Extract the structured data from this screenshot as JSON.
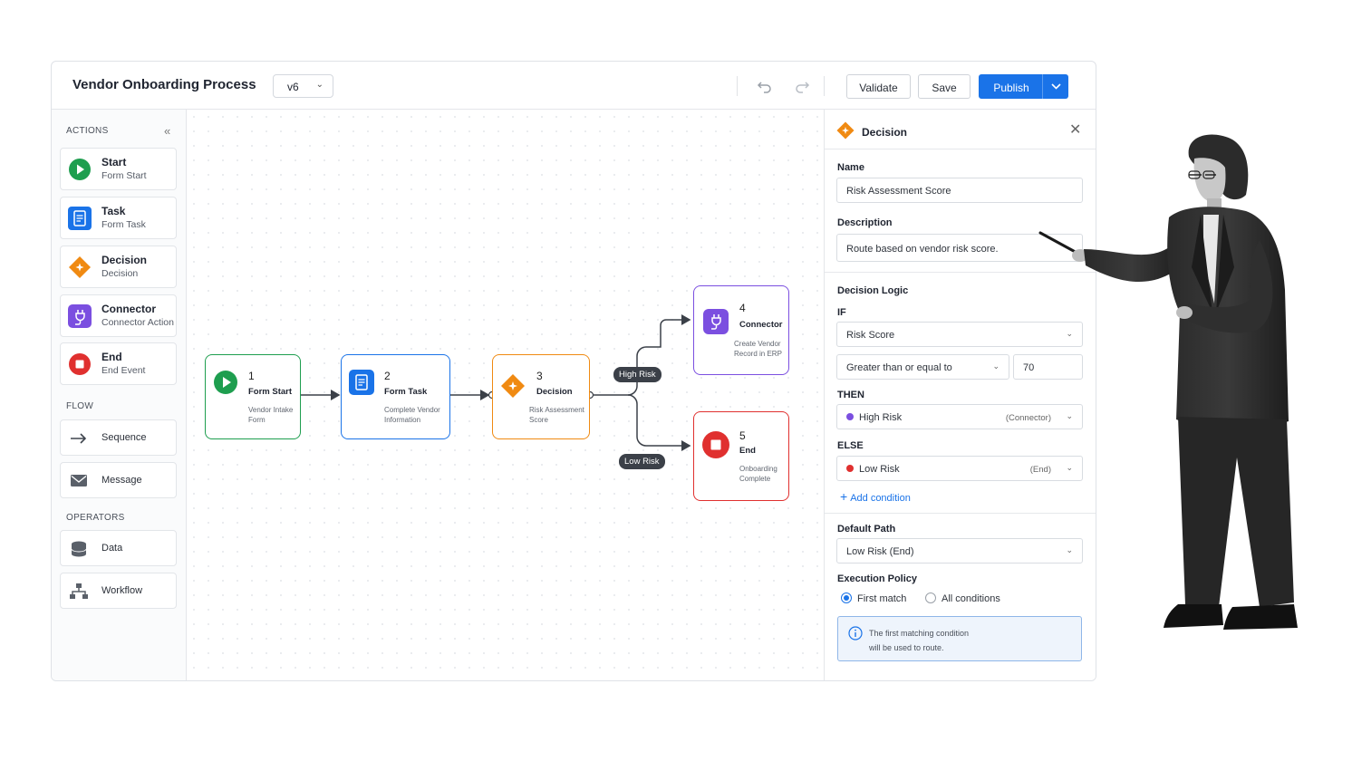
{
  "header": {
    "title": "Vendor Onboarding Process",
    "version": "v6",
    "validate_label": "Validate",
    "save_label": "Save",
    "publish_label": "Publish"
  },
  "sidebar": {
    "actions_label": "ACTIONS",
    "actions": [
      {
        "title": "Start",
        "subtitle": "Form Start",
        "icon": "play-icon",
        "color": "#1e9e4f"
      },
      {
        "title": "Task",
        "subtitle": "Form Task",
        "icon": "document-icon",
        "color": "#1a73e8"
      },
      {
        "title": "Decision",
        "subtitle": "Decision",
        "icon": "diamond-icon",
        "color": "#f08a12"
      },
      {
        "title": "Connector",
        "subtitle": "Connector Action",
        "icon": "plug-icon",
        "color": "#7b4fe0"
      },
      {
        "title": "End",
        "subtitle": "End Event",
        "icon": "stop-icon",
        "color": "#e0302f"
      }
    ],
    "flow_label": "FLOW",
    "flow": [
      {
        "title": "Sequence",
        "icon": "arrow-right-icon"
      },
      {
        "title": "Message",
        "icon": "envelope-icon"
      }
    ],
    "operators_label": "OPERATORS",
    "operators": [
      {
        "title": "Data",
        "icon": "database-icon"
      },
      {
        "title": "Workflow",
        "icon": "hierarchy-icon"
      }
    ]
  },
  "canvas": {
    "nodes": [
      {
        "num": "1",
        "title": "Form Start",
        "desc1": "Vendor Intake",
        "desc2": "Form",
        "color": "#1e9e4f"
      },
      {
        "num": "2",
        "title": "Form Task",
        "desc1": "Complete Vendor",
        "desc2": "Information",
        "color": "#1a73e8"
      },
      {
        "num": "3",
        "title": "Decision",
        "desc1": "Risk Assessment",
        "desc2": "Score",
        "color": "#f08a12"
      },
      {
        "num": "4",
        "title": "Connector",
        "desc1": "Create Vendor",
        "desc2": "Record in ERP",
        "color": "#7b4fe0"
      },
      {
        "num": "5",
        "title": "End",
        "desc1": "Onboarding",
        "desc2": "Complete",
        "color": "#e0302f"
      }
    ],
    "edge_labels": {
      "high": "High Risk",
      "low": "Low Risk"
    }
  },
  "panel": {
    "title": "Decision",
    "name_label": "Name",
    "name_value": "Risk Assessment Score",
    "description_label": "Description",
    "description_value": "Route based on vendor risk score.",
    "logic_label": "Decision Logic",
    "if_label": "IF",
    "if_field": "Risk Score",
    "operator": "Greater than or equal to",
    "threshold": "70",
    "then_label": "THEN",
    "then_value": "High Risk",
    "then_type": "(Connector)",
    "else_label": "ELSE",
    "else_value": "Low Risk",
    "else_type": "(End)",
    "add_condition": "Add condition",
    "default_label": "Default Path",
    "default_value": "Low Risk (End)",
    "policy_label": "Execution Policy",
    "policy_first": "First match",
    "policy_all": "All conditions",
    "info_line1": "The first matching condition",
    "info_line2": "will be used to route."
  }
}
